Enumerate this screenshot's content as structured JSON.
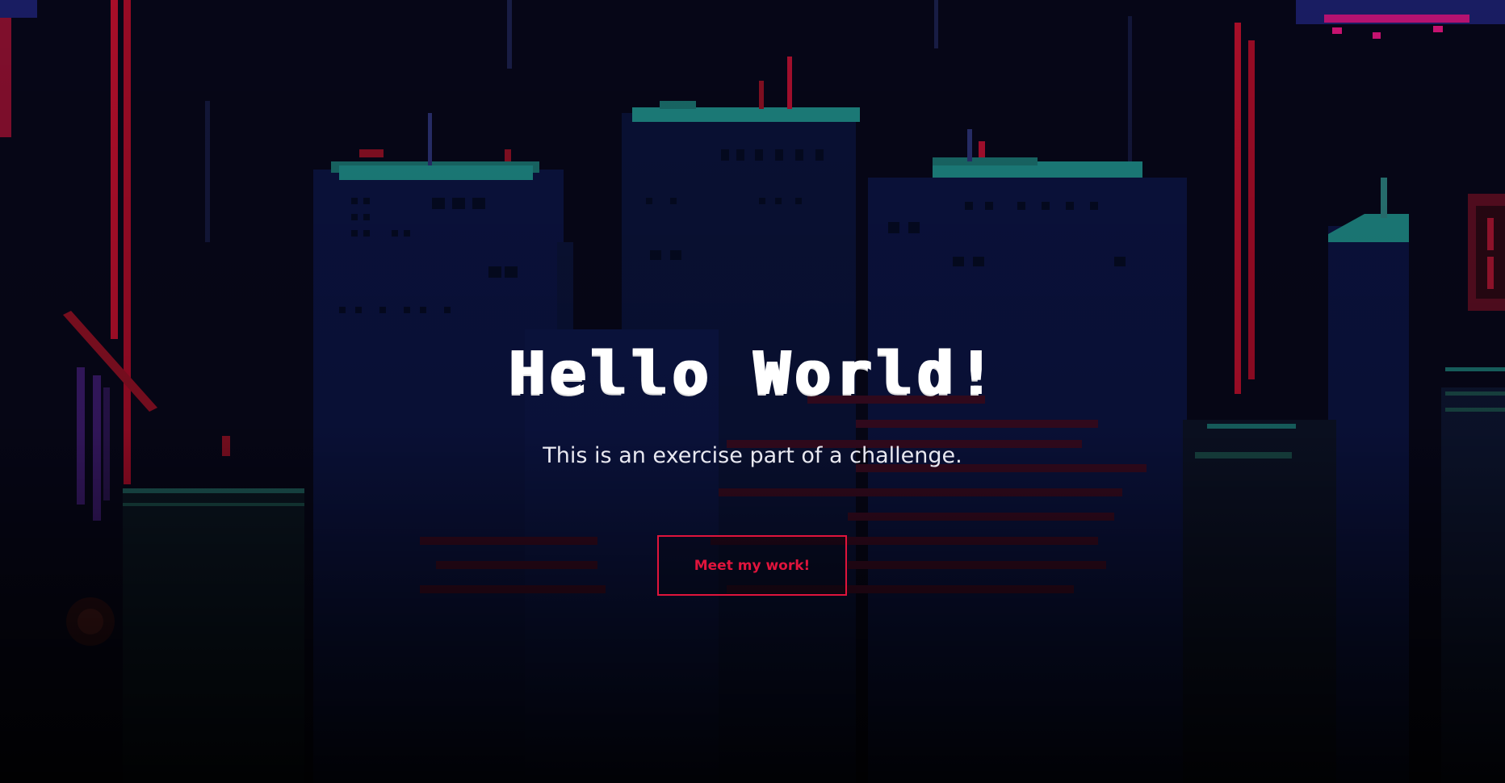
{
  "hero": {
    "title": "Hello World!",
    "subtitle": "This is an exercise part of a challenge.",
    "cta_label": "Meet my work!"
  },
  "colors": {
    "accent": "#e0143c",
    "background": "#060616",
    "building": "#0b1340",
    "rooftop": "#1f8a86",
    "neon_red": "#c4102e",
    "neon_pink": "#d8147a",
    "title": "#ffffff"
  }
}
